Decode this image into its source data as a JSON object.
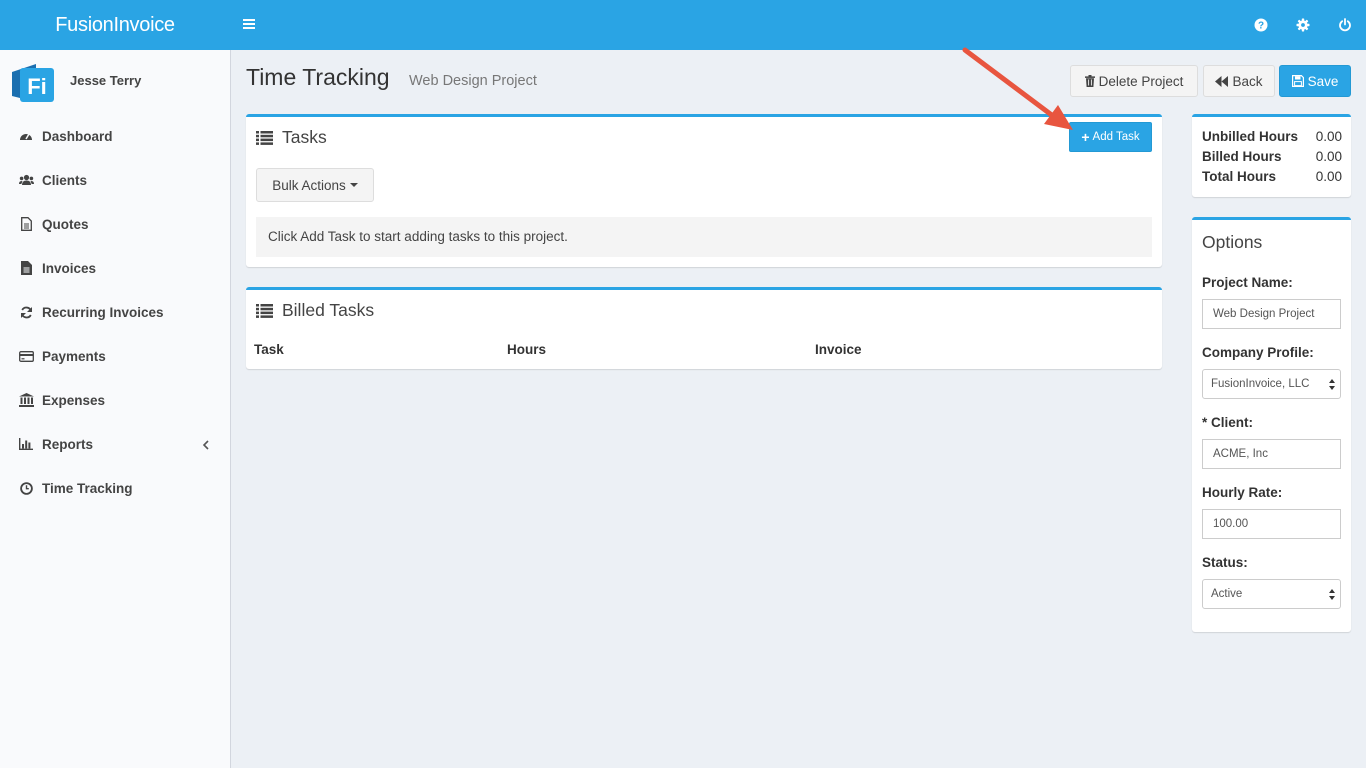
{
  "app": {
    "brand": "FusionInvoice",
    "accent_color": "#2aa4e4"
  },
  "header": {
    "icons": [
      "menu-icon",
      "help-icon",
      "gear-icon",
      "power-icon"
    ]
  },
  "user": {
    "name": "Jesse Terry",
    "avatar_icon": "fusioninvoice-logo"
  },
  "sidebar": {
    "items": [
      {
        "label": "Dashboard",
        "icon": "dashboard-icon"
      },
      {
        "label": "Clients",
        "icon": "users-icon"
      },
      {
        "label": "Quotes",
        "icon": "file-text-icon"
      },
      {
        "label": "Invoices",
        "icon": "file-icon"
      },
      {
        "label": "Recurring Invoices",
        "icon": "refresh-icon"
      },
      {
        "label": "Payments",
        "icon": "credit-card-icon"
      },
      {
        "label": "Expenses",
        "icon": "bank-icon"
      },
      {
        "label": "Reports",
        "icon": "bar-chart-icon",
        "has_submenu": true
      },
      {
        "label": "Time Tracking",
        "icon": "clock-icon"
      }
    ]
  },
  "page": {
    "title": "Time Tracking",
    "subtitle": "Web Design Project",
    "delete_label": "Delete Project",
    "back_label": "Back",
    "save_label": "Save"
  },
  "tasks": {
    "title": "Tasks",
    "add_label": "Add Task",
    "bulk_label": "Bulk Actions",
    "empty_notice": "Click Add Task to start adding tasks to this project."
  },
  "billed": {
    "title": "Billed Tasks",
    "columns": [
      "Task",
      "Hours",
      "Invoice"
    ]
  },
  "stats": {
    "rows": [
      {
        "label": "Unbilled Hours",
        "value": "0.00"
      },
      {
        "label": "Billed Hours",
        "value": "0.00"
      },
      {
        "label": "Total Hours",
        "value": "0.00"
      }
    ]
  },
  "options": {
    "title": "Options",
    "project_name_label": "Project Name:",
    "project_name_value": "Web Design Project",
    "company_label": "Company Profile:",
    "company_value": "FusionInvoice, LLC",
    "client_label": "* Client:",
    "client_value": "ACME, Inc",
    "rate_label": "Hourly Rate:",
    "rate_value": "100.00",
    "status_label": "Status:",
    "status_value": "Active"
  }
}
